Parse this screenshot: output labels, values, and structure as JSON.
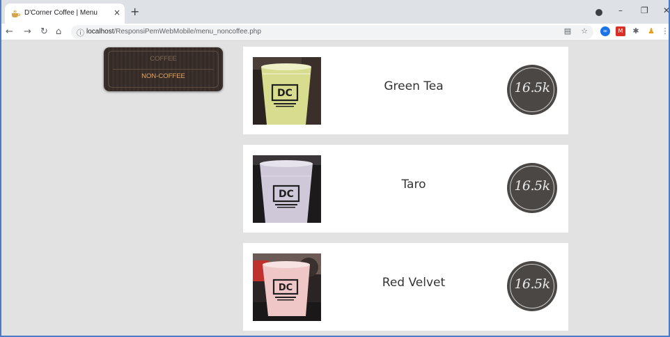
{
  "browser": {
    "tab_title": "D'Corner Coffee | Menu",
    "tab_close": "×",
    "new_tab": "+",
    "url_host": "localhost",
    "url_path": "/ResponsiPemWebMobile/menu_noncoffee.php"
  },
  "nav": {
    "coffee_label": "COFFEE",
    "noncoffee_label": "NON-COFFEE"
  },
  "menu": {
    "items": [
      {
        "name": "Green Tea",
        "price": "16.5k"
      },
      {
        "name": "Taro",
        "price": "16.5k"
      },
      {
        "name": "Red Velvet",
        "price": "16.5k"
      }
    ],
    "cup_logo": "DC"
  }
}
